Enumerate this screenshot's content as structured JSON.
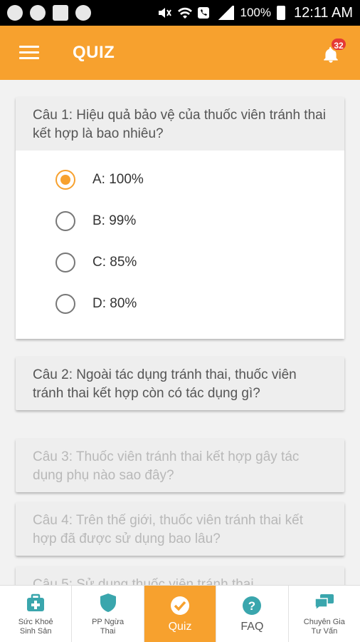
{
  "status_bar": {
    "battery_percent": "100%",
    "time": "12:11 AM"
  },
  "app_bar": {
    "title": "QUIZ",
    "notification_count": "32"
  },
  "questions": [
    {
      "text": "Câu 1: Hiệu quả bảo vệ của thuốc viên tránh thai kết hợp là bao nhiêu?",
      "expanded": true,
      "answers": [
        {
          "label": "A: 100%",
          "selected": true
        },
        {
          "label": "B: 99%",
          "selected": false
        },
        {
          "label": "C: 85%",
          "selected": false
        },
        {
          "label": "D: 80%",
          "selected": false
        }
      ]
    },
    {
      "text": "Câu 2: Ngoài tác dụng tránh thai, thuốc viên tránh thai kết hợp còn có tác dụng gì?",
      "enabled": true
    },
    {
      "text": "Câu 3: Thuốc viên tránh thai kết hợp gây tác dụng phụ nào sao đây?",
      "enabled": false
    },
    {
      "text": "Câu 4: Trên thế giới, thuốc viên tránh thai kết hợp đã được sử dụng bao lâu?",
      "enabled": false
    },
    {
      "text": "Câu 5: Sử dụng thuốc viên tránh thai",
      "enabled": false
    }
  ],
  "bottom_nav": [
    {
      "label": "Sức Khoẻ\nSinh Sản",
      "icon": "medical-kit-icon",
      "active": false
    },
    {
      "label": "PP Ngừa\nThai",
      "icon": "shield-icon",
      "active": false
    },
    {
      "label": "Quiz",
      "icon": "check-circle-icon",
      "active": true
    },
    {
      "label": "FAQ",
      "icon": "question-circle-icon",
      "active": false
    },
    {
      "label": "Chuyên Gia\nTư Vấn",
      "icon": "chat-icon",
      "active": false
    }
  ],
  "colors": {
    "accent": "#f7a12e",
    "teal": "#3aa6ad",
    "badge": "#e53935"
  }
}
